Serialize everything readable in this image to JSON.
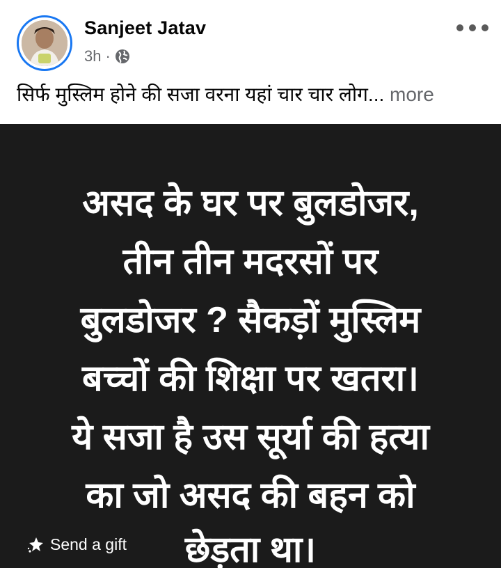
{
  "post": {
    "author": "Sanjeet Jatav",
    "time": "3h",
    "separator": "·",
    "audience_icon": "globe-icon",
    "options_icon": "more-options-icon",
    "text": "सिर्फ मुस्लिम होने की सजा वरना यहां चार चार लोग...",
    "see_more_label": "more"
  },
  "media": {
    "background": "#1b1b1b",
    "text_color": "#ffffff",
    "lines": [
      "असद के घर पर बुलडोजर,",
      "तीन तीन मदरसों पर",
      "बुलडोजर ? सैकड़ों मुस्लिम",
      "बच्चों की शिक्षा पर खतरा।",
      "ये सजा है उस सूर्या की हत्या",
      "का जो असद की बहन को",
      "छेड़ता था।"
    ]
  },
  "gift": {
    "icon": "gift-icon",
    "label": "Send a gift"
  }
}
